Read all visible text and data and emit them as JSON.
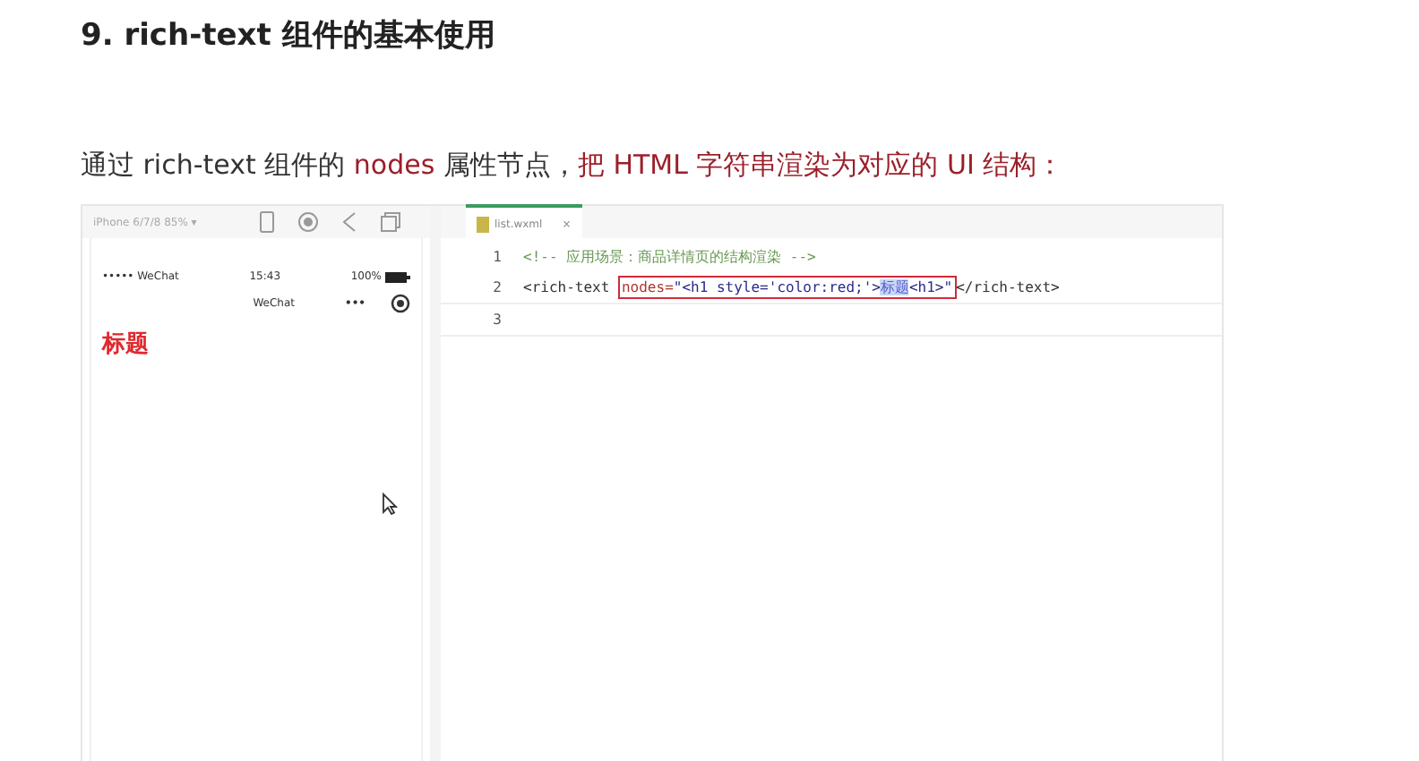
{
  "heading": "9. rich-text 组件的基本使用",
  "intro": [
    {
      "text": "通过 rich-text 组件的 ",
      "kind": "plain"
    },
    {
      "text": "nodes",
      "kind": "accent"
    },
    {
      "text": " 属性节点，",
      "kind": "plain"
    },
    {
      "text": "把 HTML 字符串渲染为对应的 UI 结构：",
      "kind": "accent"
    }
  ],
  "simulator": {
    "device": "iPhone 6/7/8 85% ▾",
    "carrier": "••••• WeChat",
    "time": "15:43",
    "battery": "100%",
    "nav_title": "WeChat",
    "nav_more": "•••",
    "page_title": "标题"
  },
  "editor": {
    "tab": {
      "label": "list.wxml",
      "close": "×",
      "selected": true
    },
    "lines": [
      {
        "number": "1",
        "parts": [
          {
            "kind": "comment",
            "text": "<!-- 应用场景：商品详情页的结构渲染 -->"
          }
        ]
      },
      {
        "number": "2",
        "parts": [
          {
            "kind": "tag",
            "text": "<rich-text "
          },
          {
            "kind": "box",
            "segments": [
              {
                "kind": "attr",
                "text": "nodes="
              },
              {
                "kind": "string",
                "text": "\"<h1 style='color:red;'>"
              },
              {
                "kind": "selected",
                "text": "标题"
              },
              {
                "kind": "string",
                "text": "<h1>\""
              }
            ]
          },
          {
            "kind": "tag",
            "text": "</rich-text>"
          }
        ]
      },
      {
        "number": "3",
        "current": true
      }
    ]
  }
}
